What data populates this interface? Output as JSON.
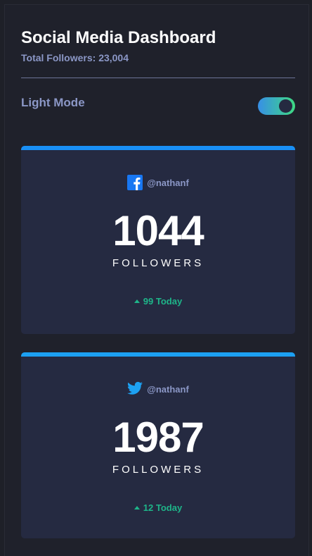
{
  "header": {
    "title": "Social Media Dashboard",
    "subtitle": "Total Followers: 23,004"
  },
  "mode": {
    "label": "Light Mode",
    "toggle_on": true
  },
  "cards": [
    {
      "platform_icon": "facebook-icon",
      "handle": "@nathanf",
      "count": "1044",
      "unit": "FOLLOWERS",
      "change": "99 Today",
      "accent": "#198ff5"
    },
    {
      "platform_icon": "twitter-icon",
      "handle": "@nathanf",
      "count": "1987",
      "unit": "FOLLOWERS",
      "change": "12 Today",
      "accent": "#1ca0f2"
    }
  ],
  "colors": {
    "background": "#1f212b",
    "card": "#252a41",
    "positive": "#1eb589",
    "muted_text": "#8b97c6"
  }
}
